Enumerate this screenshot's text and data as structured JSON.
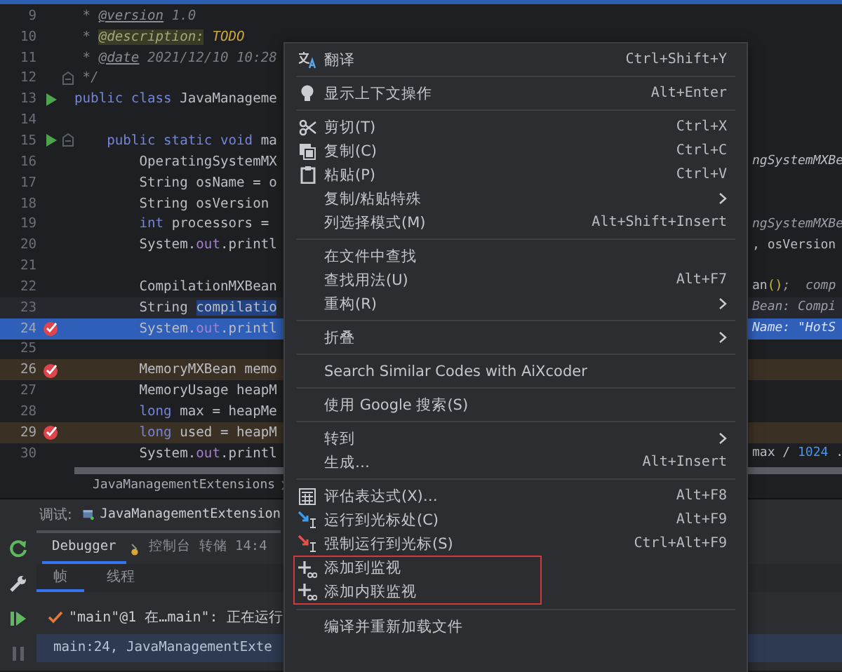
{
  "editor": {
    "lines": [
      {
        "number": "9",
        "kind": "plain",
        "selected": false,
        "current": false,
        "code": [
          {
            "text": " * ",
            "kind": "comment"
          },
          {
            "text": "@version",
            "kind": "doctag"
          },
          {
            "text": " 1.0",
            "kind": "comment"
          }
        ]
      },
      {
        "number": "10",
        "kind": "plain",
        "selected": false,
        "current": false,
        "code": [
          {
            "text": " * ",
            "kind": "comment"
          },
          {
            "text": "@description:",
            "kind": "tagbox"
          },
          {
            "text": " TODO",
            "kind": "todo"
          }
        ]
      },
      {
        "number": "11",
        "kind": "plain",
        "selected": false,
        "current": false,
        "code": [
          {
            "text": " * ",
            "kind": "comment"
          },
          {
            "text": "@date",
            "kind": "doctag"
          },
          {
            "text": " 2021/12/10 10:28",
            "kind": "comment"
          }
        ]
      },
      {
        "number": "12",
        "kind": "foldend",
        "selected": false,
        "current": false,
        "code": [
          {
            "text": " */",
            "kind": "comment"
          }
        ]
      },
      {
        "number": "13",
        "kind": "run",
        "selected": false,
        "current": false,
        "code": [
          {
            "text": "public class",
            "kind": "kw"
          },
          {
            "text": " JavaManageme",
            "kind": "plain"
          }
        ]
      },
      {
        "number": "14",
        "kind": "plain",
        "selected": false,
        "current": false
      },
      {
        "number": "15",
        "kind": "runfold",
        "selected": false,
        "current": false,
        "code": [
          {
            "text": "    public static void",
            "kind": "kw"
          },
          {
            "text": " ma",
            "kind": "plain"
          }
        ]
      },
      {
        "number": "16",
        "kind": "plain",
        "selected": false,
        "current": false,
        "code": [
          {
            "text": "        OperatingSystemMX",
            "kind": "plain"
          }
        ],
        "tail": [
          {
            "text": "ngSystemMXBe",
            "kind": "italic"
          }
        ]
      },
      {
        "number": "17",
        "kind": "plain",
        "selected": false,
        "current": false,
        "code": [
          {
            "text": "        String osName = o",
            "kind": "plain"
          }
        ]
      },
      {
        "number": "18",
        "kind": "plain",
        "selected": false,
        "current": false,
        "code": [
          {
            "text": "        String osVersion",
            "kind": "plain"
          }
        ]
      },
      {
        "number": "19",
        "kind": "plain",
        "selected": false,
        "current": false,
        "code": [
          {
            "text": "        int",
            "kind": "kw"
          },
          {
            "text": " processors =",
            "kind": "plain"
          }
        ],
        "tail": [
          {
            "text": "ngSystemMXBe",
            "kind": "hint"
          }
        ]
      },
      {
        "number": "20",
        "kind": "plain",
        "selected": false,
        "current": false,
        "code": [
          {
            "text": "        System.",
            "kind": "plain"
          },
          {
            "text": "out",
            "kind": "field"
          },
          {
            "text": ".printl",
            "kind": "plain"
          }
        ],
        "tail": [
          {
            "text": ", osVersion",
            "kind": "plain"
          }
        ]
      },
      {
        "number": "21",
        "kind": "plain",
        "selected": false,
        "current": false
      },
      {
        "number": "22",
        "kind": "plain",
        "selected": false,
        "current": false,
        "code": [
          {
            "text": "        CompilationMXBean",
            "kind": "plain"
          }
        ],
        "tail": [
          {
            "text": "an",
            "kind": "plain"
          },
          {
            "text": "()",
            "kind": "paren"
          },
          {
            "text": ";  comp",
            "kind": "hint"
          }
        ]
      },
      {
        "number": "23",
        "kind": "plain",
        "selected": false,
        "current": true,
        "code": [
          {
            "text": "        String ",
            "kind": "plain"
          },
          {
            "text": "compilatio",
            "kind": "sel"
          }
        ],
        "tail": [
          {
            "text": "Bean: Compi",
            "kind": "hint"
          }
        ]
      },
      {
        "number": "24",
        "kind": "breakpoint",
        "selected": true,
        "current": false,
        "code": [
          {
            "text": "        System.",
            "kind": "plain"
          },
          {
            "text": "out",
            "kind": "field"
          },
          {
            "text": ".printl",
            "kind": "plain"
          }
        ],
        "tail": [
          {
            "text": "Name: \"HotS",
            "kind": "hint"
          }
        ]
      },
      {
        "number": "25",
        "kind": "plain",
        "selected": false,
        "current": false
      },
      {
        "number": "26",
        "kind": "breakpoint",
        "selected": false,
        "current": false,
        "code": [
          {
            "text": "        MemoryMXBean memo",
            "kind": "plain"
          }
        ]
      },
      {
        "number": "27",
        "kind": "plain",
        "selected": false,
        "current": false,
        "code": [
          {
            "text": "        MemoryUsage heapM",
            "kind": "plain"
          }
        ]
      },
      {
        "number": "28",
        "kind": "plain",
        "selected": false,
        "current": false,
        "code": [
          {
            "text": "        long",
            "kind": "kw"
          },
          {
            "text": " max = heapMe",
            "kind": "plain"
          }
        ]
      },
      {
        "number": "29",
        "kind": "breakpoint",
        "selected": false,
        "current": false,
        "code": [
          {
            "text": "        long",
            "kind": "kw"
          },
          {
            "text": " used = heapM",
            "kind": "plain"
          }
        ]
      },
      {
        "number": "30",
        "kind": "plain",
        "selected": false,
        "current": false,
        "code": [
          {
            "text": "        System.",
            "kind": "plain"
          },
          {
            "text": "out",
            "kind": "field"
          },
          {
            "text": ".printl",
            "kind": "plain"
          }
        ],
        "tail": [
          {
            "text": "max / ",
            "kind": "plain"
          },
          {
            "text": "1024",
            "kind": "number"
          },
          {
            "text": " .",
            "kind": "plain"
          }
        ]
      }
    ]
  },
  "breadcrumb": {
    "label": "JavaManagementExtensions"
  },
  "debug": {
    "title": "调试:",
    "session": "JavaManagementExtension",
    "tabs": [
      {
        "label": "Debugger",
        "selected": true
      },
      {
        "label": "控制台",
        "selected": false
      },
      {
        "label": "转储 14:4",
        "selected": false
      }
    ],
    "subtabs": [
      {
        "label": "帧",
        "selected": true
      },
      {
        "label": "线程",
        "selected": false
      }
    ],
    "thread": "\"main\"@1 在…main\": 正在运行",
    "frames": [
      {
        "label": "main:24, JavaManagementExte",
        "selected": true
      }
    ]
  },
  "menu": {
    "sections": [
      {
        "highlighted": false,
        "items": [
          {
            "label": "翻译",
            "shortcut": "Ctrl+Shift+Y",
            "submenu": false
          }
        ]
      },
      {
        "highlighted": false,
        "items": [
          {
            "label": "显示上下文操作",
            "shortcut": "Alt+Enter",
            "submenu": false
          }
        ]
      },
      {
        "highlighted": false,
        "items": [
          {
            "label": "剪切(T)",
            "shortcut": "Ctrl+X",
            "submenu": false
          },
          {
            "label": "复制(C)",
            "shortcut": "Ctrl+C",
            "submenu": false
          },
          {
            "label": "粘贴(P)",
            "shortcut": "Ctrl+V",
            "submenu": false
          },
          {
            "label": "复制/粘贴特殊",
            "submenu": true
          },
          {
            "label": "列选择模式(M)",
            "shortcut": "Alt+Shift+Insert",
            "submenu": false
          }
        ]
      },
      {
        "highlighted": false,
        "items": [
          {
            "label": "在文件中查找",
            "submenu": false
          },
          {
            "label": "查找用法(U)",
            "shortcut": "Alt+F7",
            "submenu": false
          },
          {
            "label": "重构(R)",
            "submenu": true
          }
        ]
      },
      {
        "highlighted": false,
        "items": [
          {
            "label": "折叠",
            "submenu": true
          }
        ]
      },
      {
        "highlighted": false,
        "items": [
          {
            "label": "Search Similar Codes with AiXcoder",
            "submenu": false
          }
        ]
      },
      {
        "highlighted": false,
        "items": [
          {
            "label": "使用 Google 搜索(S)",
            "submenu": false
          }
        ]
      },
      {
        "highlighted": false,
        "items": [
          {
            "label": "转到",
            "submenu": true
          },
          {
            "label": "生成…",
            "shortcut": "Alt+Insert",
            "submenu": false
          }
        ]
      },
      {
        "highlighted": false,
        "items": [
          {
            "label": "评估表达式(X)…",
            "shortcut": "Alt+F8",
            "submenu": false
          },
          {
            "label": "运行到光标处(C)",
            "shortcut": "Alt+F9",
            "submenu": false
          },
          {
            "label": "强制运行到光标(S)",
            "shortcut": "Ctrl+Alt+F9",
            "submenu": false
          }
        ]
      },
      {
        "highlighted": true,
        "items": [
          {
            "label": "添加到监视",
            "submenu": false
          },
          {
            "label": "添加内联监视",
            "submenu": false
          }
        ]
      },
      {
        "highlighted": false,
        "items": [
          {
            "label": "编译并重新加载文件",
            "submenu": false
          }
        ]
      }
    ]
  }
}
